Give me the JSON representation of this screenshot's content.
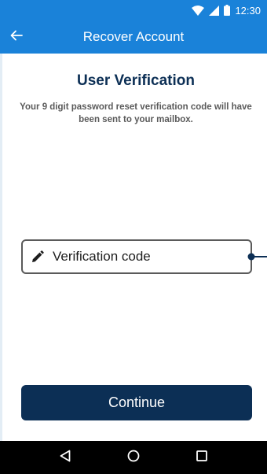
{
  "status_bar": {
    "time": "12:30",
    "icons": [
      "wifi-icon",
      "signal-icon",
      "battery-icon"
    ]
  },
  "app_bar": {
    "title": "Recover Account",
    "back_icon": "arrow-left-icon"
  },
  "content": {
    "heading": "User Verification",
    "subtext": "Your 9 digit password reset verification code will have been sent to your mailbox.",
    "verification_field": {
      "placeholder": "Verification code",
      "icon": "pencil-icon"
    },
    "continue_label": "Continue"
  },
  "nav_bar": {
    "icons": [
      "back-triangle-icon",
      "home-circle-icon",
      "recents-square-icon"
    ]
  },
  "colors": {
    "primary": "#1a82d9",
    "navy": "#0c2f55",
    "text_grey": "#5a5a5a",
    "nav_bg": "#000000"
  }
}
